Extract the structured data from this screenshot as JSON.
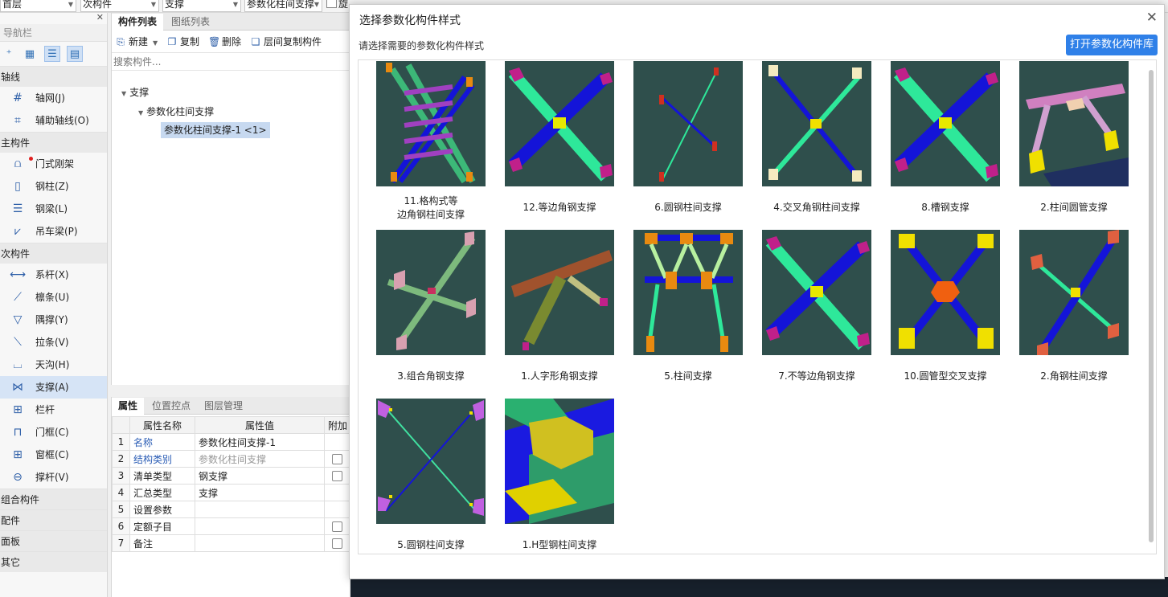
{
  "topbar": {
    "floor": "首层",
    "category": "次构件",
    "type": "支撑",
    "component": "参数化柱间支撑",
    "cut_label": "旋"
  },
  "nav": {
    "title": "导航栏",
    "categories": {
      "axis": "轴线",
      "main": "主构件",
      "secondary": "次构件",
      "combo": "组合构件",
      "parts": "配件",
      "panel": "面板",
      "other": "其它"
    },
    "items": {
      "grid": "轴网(J)",
      "aux_axis": "辅助轴线(O)",
      "portal_frame": "门式刚架",
      "steel_column": "钢柱(Z)",
      "steel_beam": "钢梁(L)",
      "crane_beam": "吊车梁(P)",
      "tie_rod": "系杆(X)",
      "purlin": "檩条(U)",
      "knee_brace": "隅撑(Y)",
      "pull_bar": "拉条(V)",
      "gutter": "天沟(H)",
      "brace": "支撑(A)",
      "railing": "栏杆",
      "door_frame": "门框(C)",
      "window_frame": "窗框(C)",
      "strut": "撑杆(V)"
    }
  },
  "complist": {
    "tab_components": "构件列表",
    "tab_drawings": "图纸列表",
    "new": "新建",
    "copy": "复制",
    "delete": "删除",
    "floor_copy": "层间复制构件",
    "search_placeholder": "搜索构件...",
    "tree_root": "支撑",
    "tree_group": "参数化柱间支撑",
    "tree_leaf": "参数化柱间支撑-1 <1>"
  },
  "props": {
    "tab_props": "属性",
    "tab_pos": "位置控点",
    "tab_layers": "图层管理",
    "col_name": "属性名称",
    "col_value": "属性值",
    "col_extra": "附加",
    "rows": [
      {
        "num": "1",
        "name": "名称",
        "value": "参数化柱间支撑-1"
      },
      {
        "num": "2",
        "name": "结构类别",
        "value": "参数化柱间支撑"
      },
      {
        "num": "3",
        "name": "清单类型",
        "value": "钢支撑"
      },
      {
        "num": "4",
        "name": "汇总类型",
        "value": "支撑"
      },
      {
        "num": "5",
        "name": "设置参数",
        "value": ""
      },
      {
        "num": "6",
        "name": "定额子目",
        "value": ""
      },
      {
        "num": "7",
        "name": "备注",
        "value": ""
      }
    ]
  },
  "dialog": {
    "title": "选择参数化构件样式",
    "subtitle": "请选择需要的参数化构件样式",
    "open_library": "打开参数化构件库",
    "close_icon": "close-icon",
    "styles": [
      "11.格构式等\n边角钢柱间支撑",
      "12.等边角钢支撑",
      "6.圆钢柱间支撑",
      "4.交叉角钢柱间支撑",
      "8.槽钢支撑",
      "2.柱间圆管支撑",
      "3.组合角钢支撑",
      "1.人字形角钢支撑",
      "5.柱间支撑",
      "7.不等边角钢支撑",
      "10.圆管型交叉支撑",
      "2.角钢柱间支撑",
      "5.圆钢柱间支撑",
      "1.H型钢柱间支撑"
    ]
  },
  "colors": {
    "thumb_bg": "#2f4f4c",
    "accent": "#2f80e8",
    "member_blue": "#1414d8",
    "member_green": "#2ee89a",
    "plate_magenta": "#c0208a",
    "plate_orange": "#e88a10",
    "plate_yellow": "#f0e000"
  }
}
